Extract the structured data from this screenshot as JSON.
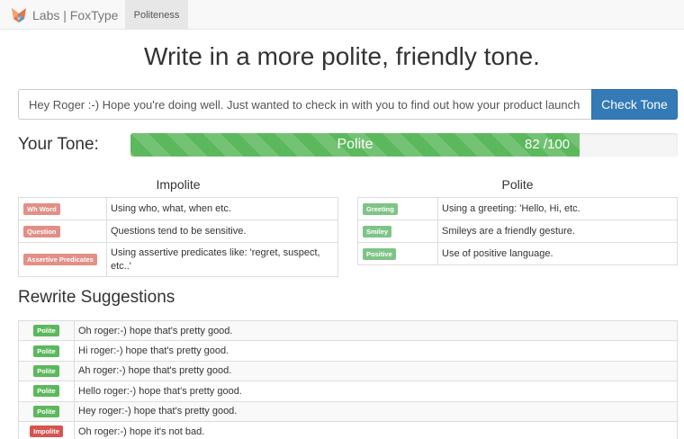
{
  "navbar": {
    "brand": "Labs | FoxType",
    "logo_icon": "fox-logo-icon",
    "tab": "Politeness"
  },
  "heading": "Write in a more polite, friendly tone.",
  "input": {
    "value": "Hey Roger :-) Hope you're doing well. Just wanted to check in with you to find out how your product launch went."
  },
  "check_button": "Check Tone",
  "tone": {
    "label": "Your Tone:",
    "result": "Polite",
    "score_text": "82 /100",
    "score": 82,
    "max": 100,
    "bar_color": "#5cb85c"
  },
  "impolite": {
    "title": "Impolite",
    "color": "#e28f87",
    "rows": [
      {
        "tag": "Wh Word",
        "desc": "Using who, what, when etc."
      },
      {
        "tag": "Question",
        "desc": "Questions tend to be sensitive."
      },
      {
        "tag": "Assertive Predicates",
        "desc": "Using assertive predicates like: 'regret, suspect, etc..'"
      }
    ]
  },
  "polite": {
    "title": "Polite",
    "color": "#7fc487",
    "rows": [
      {
        "tag": "Greeting",
        "desc": "Using a greeting: 'Hello, Hi, etc."
      },
      {
        "tag": "Smiley",
        "desc": "Smileys are a friendly gesture."
      },
      {
        "tag": "Positive",
        "desc": "Use of positive language."
      }
    ]
  },
  "rewrite": {
    "title": "Rewrite Suggestions",
    "rows": [
      {
        "badge": "Polite",
        "kind": "green",
        "text": "Oh roger:-) hope that's pretty good."
      },
      {
        "badge": "Polite",
        "kind": "green",
        "text": "Hi roger:-) hope that's pretty good."
      },
      {
        "badge": "Polite",
        "kind": "green",
        "text": "Ah roger:-) hope that's pretty good."
      },
      {
        "badge": "Polite",
        "kind": "green",
        "text": "Hello roger:-) hope that's pretty good."
      },
      {
        "badge": "Polite",
        "kind": "green",
        "text": "Hey roger:-) hope that's pretty good."
      },
      {
        "badge": "Impolite",
        "kind": "red",
        "text": "Oh roger:-) hope it's not bad."
      }
    ]
  }
}
